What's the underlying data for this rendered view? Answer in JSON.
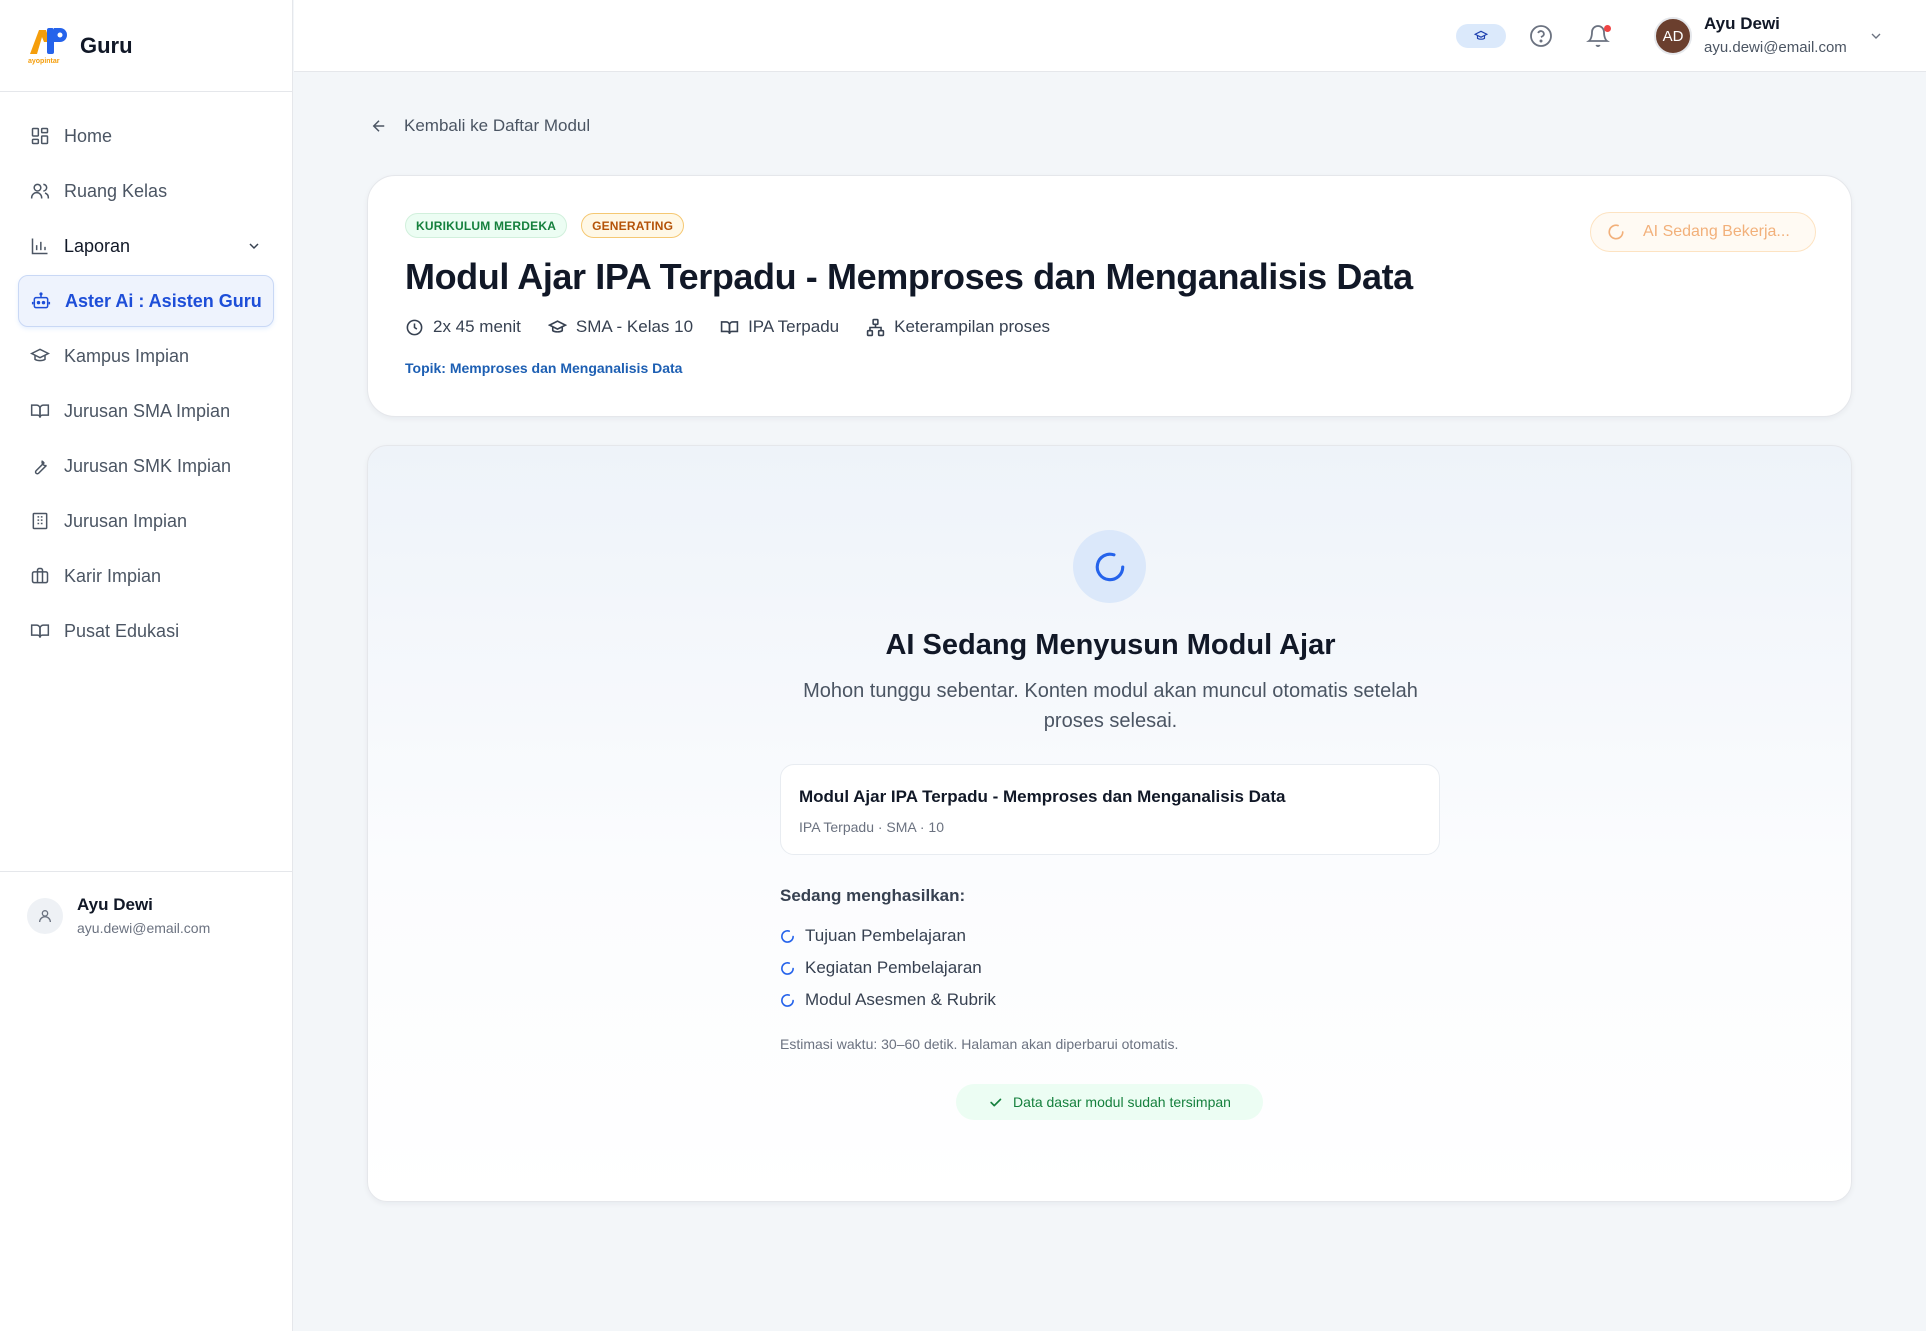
{
  "brand": {
    "logo_letters": "AP",
    "logo_caption": "ayopintar",
    "name": "Guru"
  },
  "sidebar": {
    "items": [
      {
        "label": "Home",
        "icon": "grid-icon"
      },
      {
        "label": "Ruang Kelas",
        "icon": "users-icon"
      },
      {
        "label": "Laporan",
        "icon": "bar-chart-icon"
      },
      {
        "label": "Aster Ai : Asisten Guru",
        "icon": "robot-icon"
      },
      {
        "label": "Kampus Impian",
        "icon": "graduation-cap-icon"
      },
      {
        "label": "Jurusan SMA Impian",
        "icon": "book-open-icon"
      },
      {
        "label": "Jurusan SMK Impian",
        "icon": "wrench-icon"
      },
      {
        "label": "Jurusan Impian",
        "icon": "building-icon"
      },
      {
        "label": "Karir Impian",
        "icon": "briefcase-icon"
      },
      {
        "label": "Pusat Edukasi",
        "icon": "book-icon"
      }
    ],
    "active_index": 3,
    "user": {
      "name": "Ayu Dewi",
      "email": "ayu.dewi@email.com"
    }
  },
  "topbar": {
    "user": {
      "initials": "AD",
      "name": "Ayu Dewi",
      "email": "ayu.dewi@email.com"
    },
    "has_notification": true
  },
  "back_link": "Kembali ke Daftar Modul",
  "module": {
    "badges": [
      "KURIKULUM MERDEKA",
      "GENERATING"
    ],
    "status_button": "AI Sedang Bekerja...",
    "title": "Modul Ajar IPA Terpadu - Memproses dan Menganalisis Data",
    "meta": {
      "duration": "2x 45 menit",
      "level": "SMA - Kelas 10",
      "subject": "IPA Terpadu",
      "skill": "Keterampilan proses"
    },
    "topic": "Topik: Memproses dan Menganalisis Data"
  },
  "generation": {
    "title": "AI Sedang Menyusun Modul Ajar",
    "subtitle": "Mohon tunggu sebentar. Konten modul akan muncul otomatis setelah proses selesai.",
    "card_title": "Modul Ajar IPA Terpadu - Memproses dan Menganalisis Data",
    "card_sub": "IPA Terpadu · SMA · 10",
    "list_label": "Sedang menghasilkan:",
    "items": [
      "Tujuan Pembelajaran",
      "Kegiatan Pembelajaran",
      "Modul Asesmen & Rubrik"
    ],
    "estimate": "Estimasi waktu: 30–60 detik. Halaman akan diperbarui otomatis.",
    "saved_note": "Data dasar modul sudah tersimpan"
  },
  "colors": {
    "accent": "#1d4ed8",
    "success": "#15803d",
    "warning": "#b45309"
  }
}
